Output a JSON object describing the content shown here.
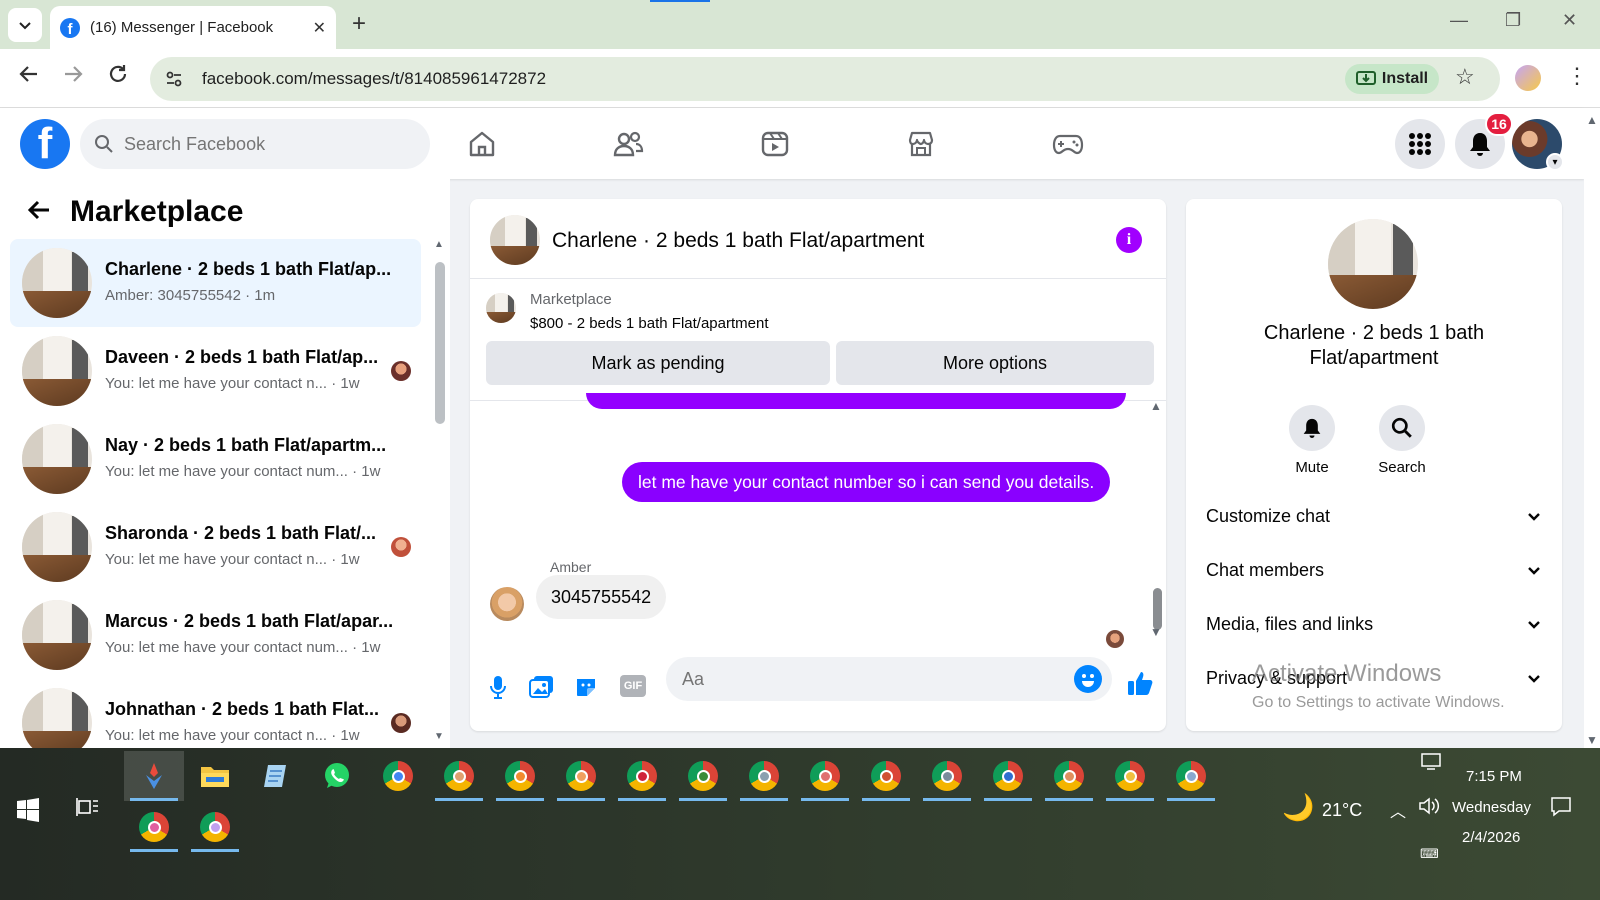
{
  "browser": {
    "tab_title": "(16) Messenger | Facebook",
    "url": "facebook.com/messages/t/814085961472872",
    "install_label": "Install"
  },
  "fb": {
    "search_placeholder": "Search Facebook",
    "notification_count": "16"
  },
  "left": {
    "title": "Marketplace",
    "conversations": [
      {
        "name": "Charlene · 2 beds 1 bath Flat/ap...",
        "snippet": "Amber: 3045755542 · 1m",
        "active": true
      },
      {
        "name": "Daveen · 2 beds 1 bath Flat/ap...",
        "snippet": "You: let me have your contact n... · 1w"
      },
      {
        "name": "Nay · 2 beds 1 bath Flat/apartm...",
        "snippet": "You: let me have your contact num... · 1w"
      },
      {
        "name": "Sharonda · 2 beds 1 bath Flat/...",
        "snippet": "You: let me have your contact n... · 1w"
      },
      {
        "name": "Marcus · 2 beds 1 bath Flat/apar...",
        "snippet": "You: let me have your contact num... · 1w"
      },
      {
        "name": "Johnathan · 2 beds 1 bath Flat...",
        "snippet": "You: let me have your contact n... · 1w"
      }
    ]
  },
  "chat": {
    "title": "Charlene · 2 beds 1 bath Flat/apartment",
    "marketplace_label": "Marketplace",
    "listing": "$800 - 2 beds 1 bath Flat/apartment",
    "mark_pending": "Mark as pending",
    "more_options": "More options",
    "outgoing_message": "let me have your contact number so i can send you details.",
    "sender_name": "Amber",
    "incoming_message": "3045755542",
    "composer_placeholder": "Aa"
  },
  "info": {
    "name": "Charlene · 2 beds 1 bath Flat/apartment",
    "mute": "Mute",
    "search": "Search",
    "sections": [
      "Customize chat",
      "Chat members",
      "Media, files and links",
      "Privacy & support"
    ]
  },
  "watermark": {
    "line1": "Activate Windows",
    "line2": "Go to Settings to activate Windows."
  },
  "taskbar": {
    "temperature": "21°C",
    "time": "7:15 PM",
    "day": "Wednesday",
    "date": "2/4/2026"
  },
  "colors": {
    "fb_blue": "#1877f2",
    "messenger_purple": "#8a00ff",
    "badge_red": "#e41e3f"
  }
}
